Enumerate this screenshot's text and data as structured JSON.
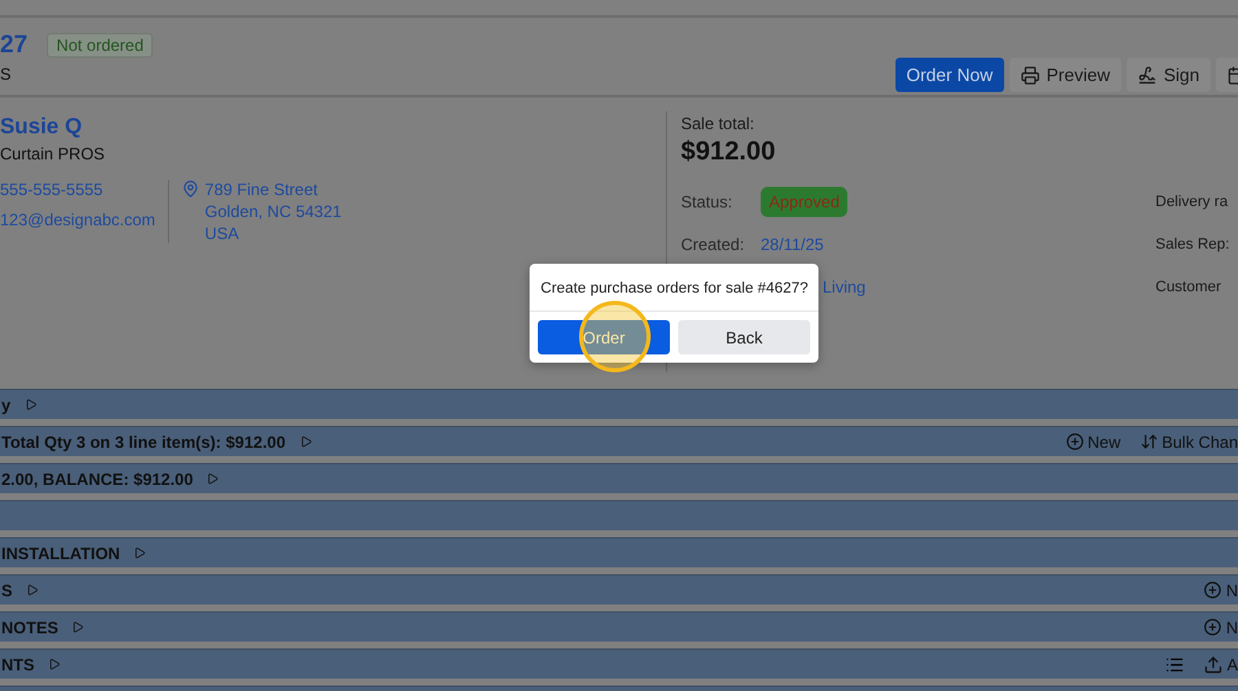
{
  "header": {
    "title": "27",
    "status_badge": "Not ordered",
    "subtitle": "S",
    "actions": [
      {
        "kind": "primary",
        "label": "Order Now"
      },
      {
        "kind": "print",
        "label": "Preview"
      },
      {
        "kind": "sign",
        "label": "Sign"
      },
      {
        "kind": "calendar"
      }
    ]
  },
  "customer": {
    "name": "Susie Q",
    "company": "Curtain PROS",
    "phone": "555-555-5555",
    "email": "123@designabc.com",
    "address": [
      "789 Fine Street",
      "Golden, NC 54321",
      "USA"
    ]
  },
  "sale": {
    "total_label": "Sale total:",
    "total": "$912.00",
    "fields": [
      {
        "kind": "badge",
        "label": "Status:",
        "value": "Approved"
      },
      {
        "kind": "link",
        "label": "Created:",
        "value": "28/11/25"
      },
      {
        "kind": "covered_link",
        "value": "Living"
      }
    ],
    "side_labels": [
      "Delivery ra",
      "Sales Rep:",
      "Customer"
    ]
  },
  "sections": [
    {
      "kind": "section",
      "title": "y"
    },
    {
      "kind": "section",
      "title": "Total Qty 3 on 3 line item(s): $912.00",
      "actions": [
        {
          "kind": "add",
          "label": "New"
        },
        {
          "kind": "bulk",
          "label": "Bulk Chan"
        }
      ]
    },
    {
      "kind": "section",
      "title": "2.00, BALANCE: $912.00"
    },
    {
      "kind": "blank"
    },
    {
      "kind": "section",
      "title": "INSTALLATION"
    },
    {
      "kind": "section",
      "title": "S",
      "actions": [
        {
          "kind": "add",
          "label": "N"
        }
      ]
    },
    {
      "kind": "section",
      "title": "NOTES",
      "actions": [
        {
          "kind": "add",
          "label": "N"
        }
      ]
    },
    {
      "kind": "section",
      "title": "NTS",
      "actions": [
        {
          "kind": "list"
        },
        {
          "kind": "upload",
          "label": "A"
        }
      ]
    },
    {
      "kind": "blank"
    }
  ],
  "dialog": {
    "message": "Create purchase orders for sale #4627?",
    "buttons": [
      {
        "kind": "primary",
        "label": "Order",
        "highlighted": true
      },
      {
        "kind": "secondary",
        "label": "Back",
        "highlighted": false
      }
    ]
  }
}
